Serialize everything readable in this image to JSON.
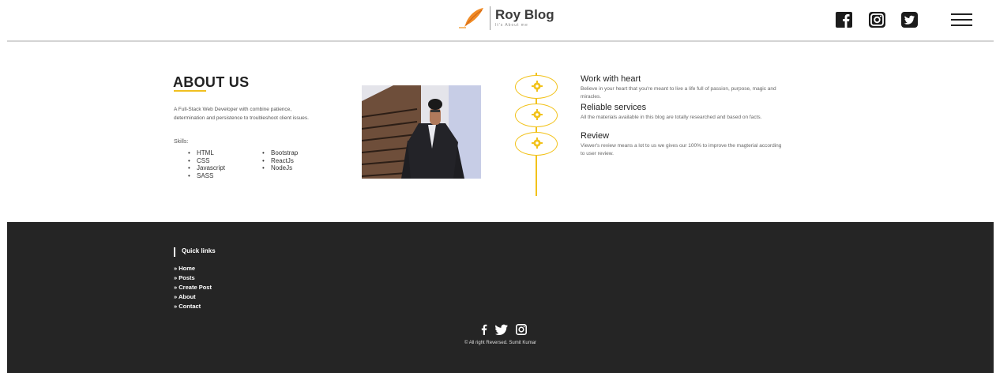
{
  "header": {
    "logo_title": "Roy Blog",
    "logo_tagline": "It's About me",
    "social_icons": [
      "facebook-icon",
      "instagram-icon",
      "twitter-icon"
    ],
    "menu_icon": "hamburger-menu-icon"
  },
  "about": {
    "title": "ABOUT US",
    "description": "A Full-Stack Web Developer with combine patience, determination and persistence to troubleshoot client issues.",
    "skills_label": "Skills:",
    "skills_col1": [
      "HTML",
      "CSS",
      "Javascript",
      "SASS"
    ],
    "skills_col2": [
      "Bootstrap",
      "ReactJs",
      "NodeJs"
    ]
  },
  "features": [
    {
      "title": "Work with heart",
      "desc": "Believe in your heart that you're meant to live a life full of passion, purpose, magic and miracles."
    },
    {
      "title": "Reliable services",
      "desc": "All the materials available in this blog are totally researched and based on facts."
    },
    {
      "title": "Review",
      "desc": "Viewer's review means a lot to us we gives our 100% to improve the magterial according to user review."
    }
  ],
  "footer": {
    "quick_links_title": "Quick links",
    "links": [
      "Home",
      "Posts",
      "Create Post",
      "About",
      "Contact"
    ],
    "social_icons": [
      "facebook-icon",
      "twitter-icon",
      "instagram-icon"
    ],
    "copyright": "© All right Reversed. Sumit Kumar"
  },
  "colors": {
    "accent": "#f2c21a",
    "footer_bg": "#252525",
    "logo_feather": "#f08a24"
  }
}
